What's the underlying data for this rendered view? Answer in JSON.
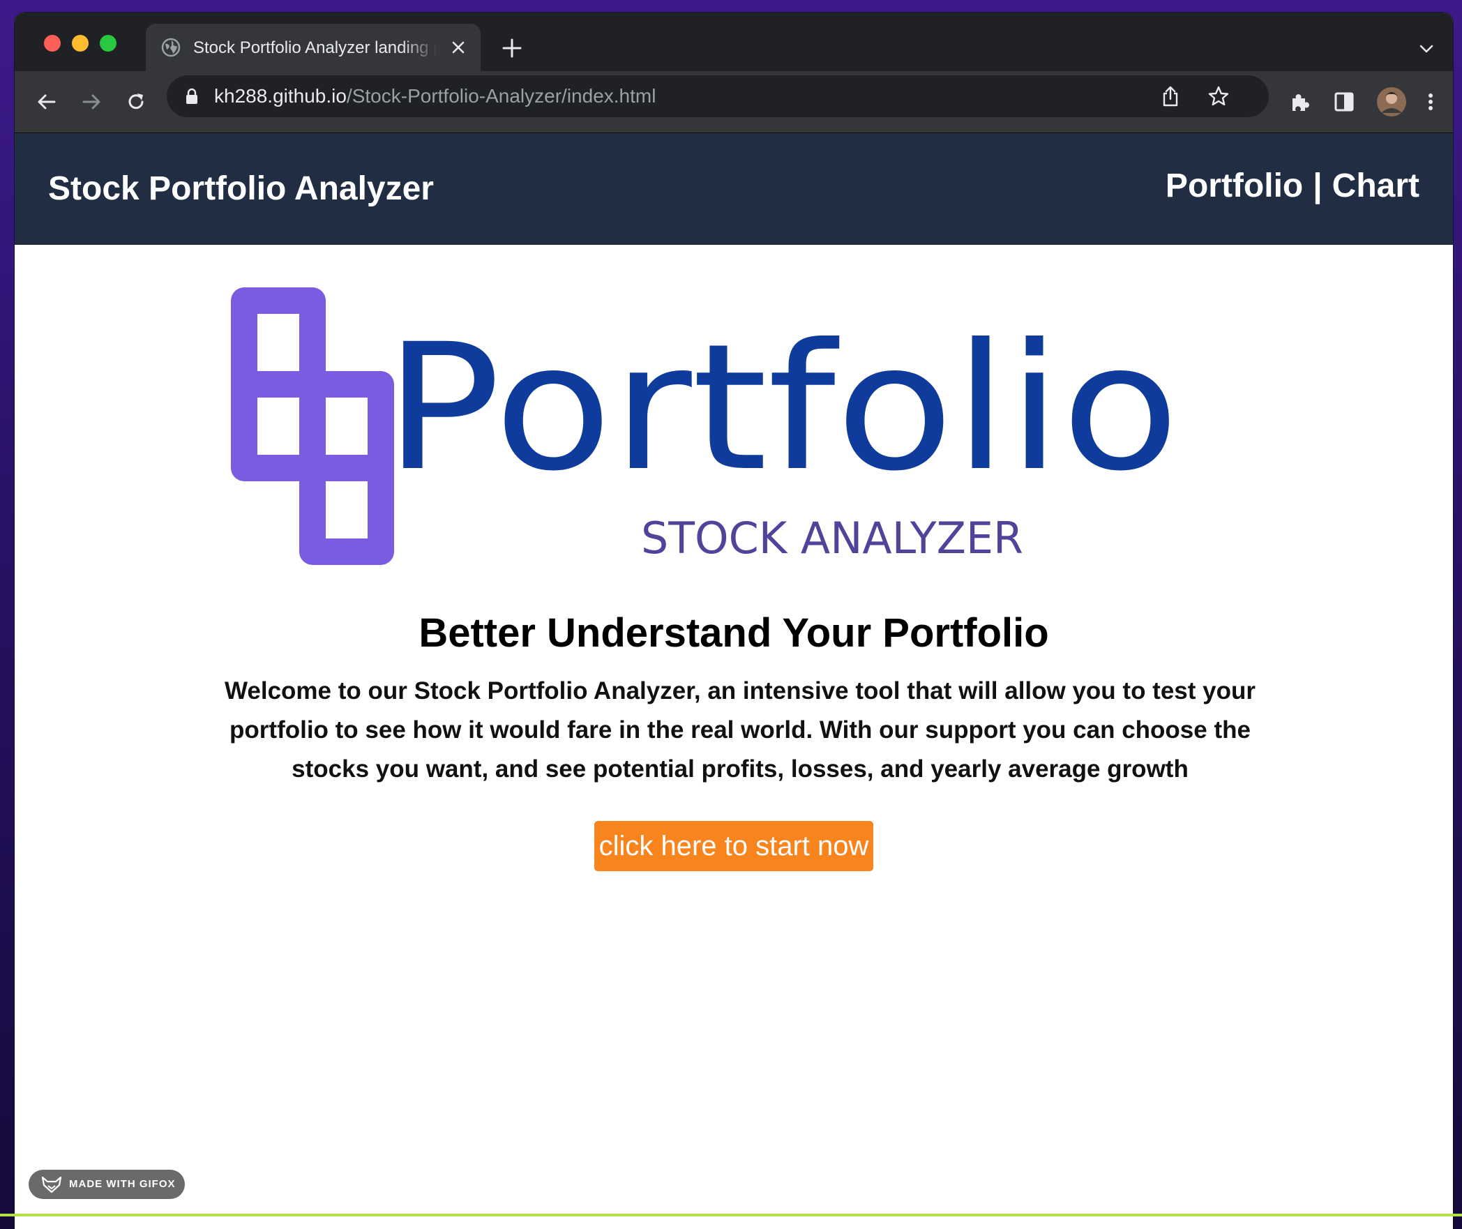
{
  "browser": {
    "tab_title": "Stock Portfolio Analyzer landing page",
    "url_host": "kh288.github.io",
    "url_path": "/Stock-Portfolio-Analyzer/index.html"
  },
  "site": {
    "title": "Stock Portfolio Analyzer",
    "nav": {
      "portfolio": "Portfolio",
      "separator": "|",
      "chart": "Chart"
    }
  },
  "logo": {
    "word": "Portfolio",
    "tagline": "STOCK ANALYZER"
  },
  "hero": {
    "title": "Better Understand Your Portfolio",
    "description_lines": [
      "Welcome to our Stock Portfolio Analyzer, an intensive tool that will allow you to test your",
      "portfolio to see how it would fare in the real world. With our support you can choose the",
      "stocks you want, and see potential profits, losses, and yearly average growth"
    ],
    "cta_label": "click here to start now"
  },
  "watermark": {
    "label": "MADE WITH GIFOX"
  },
  "colors": {
    "header_bg": "#212d43",
    "cta_bg": "#f8841e",
    "logo_purple": "#7b5ce1",
    "logo_blue": "#0f3b9c"
  }
}
